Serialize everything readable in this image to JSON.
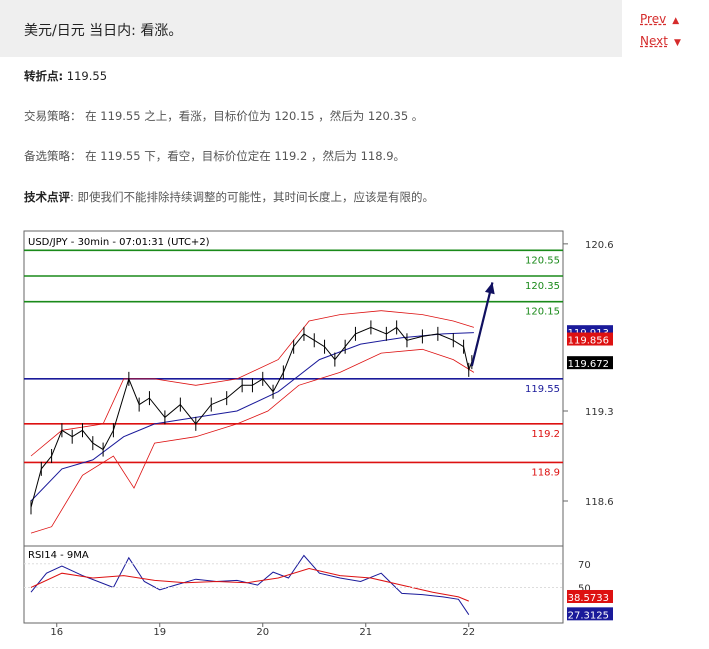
{
  "header": {
    "title": "美元/日元 当日内: 看涨。",
    "prev_label": "Prev",
    "next_label": "Next"
  },
  "analysis": {
    "pivot_label": "转折点:",
    "pivot_value": "119.55",
    "strategy_label": "交易策略：",
    "strategy_text": "在 119.55 之上，看涨，目标价位为 120.15 ，然后为 120.35 。",
    "alternative_label": "备选策略：",
    "alternative_text": "在 119.55 下，看空，目标价位定在 119.2 ，然后为 118.9。",
    "comment_label": "技术点评",
    "comment_text": ": 即使我们不能排除持续调整的可能性，其时间长度上，应该是有限的。"
  },
  "colors": {
    "accent": "#d52b2b",
    "resistance": "#1a8a1a",
    "pivot": "#1a1a9a",
    "support": "#dd1111",
    "bollinger": "#dd1111",
    "moving_average": "#1a1a9a"
  },
  "chart_data": [
    {
      "type": "candlestick",
      "title": "USD/JPY - 30min - 07:01:31 (UTC+2)",
      "ylim": [
        118.25,
        120.7
      ],
      "y_ticks": [
        120.6,
        119.3,
        118.6
      ],
      "x_ticks": [
        "16",
        "19",
        "20",
        "21",
        "22"
      ],
      "levels": [
        {
          "label": "120.55",
          "value": 120.55,
          "kind": "resistance"
        },
        {
          "label": "120.35",
          "value": 120.35,
          "kind": "resistance"
        },
        {
          "label": "120.15",
          "value": 120.15,
          "kind": "resistance"
        },
        {
          "label": "119.55",
          "value": 119.55,
          "kind": "pivot"
        },
        {
          "label": "119.2",
          "value": 119.2,
          "kind": "support"
        },
        {
          "label": "118.9",
          "value": 118.9,
          "kind": "support"
        }
      ],
      "price_tags": [
        {
          "label": "119.913",
          "value": 119.913,
          "bg": "#1a1a9a"
        },
        {
          "label": "119.856",
          "value": 119.856,
          "bg": "#dd1111"
        },
        {
          "label": "119.672",
          "value": 119.672,
          "bg": "#000000"
        }
      ],
      "price_path": [
        {
          "x": 0.0,
          "y": 118.55
        },
        {
          "x": 0.1,
          "y": 118.85
        },
        {
          "x": 0.2,
          "y": 118.95
        },
        {
          "x": 0.3,
          "y": 119.15
        },
        {
          "x": 0.4,
          "y": 119.1
        },
        {
          "x": 0.5,
          "y": 119.15
        },
        {
          "x": 0.6,
          "y": 119.05
        },
        {
          "x": 0.7,
          "y": 119.0
        },
        {
          "x": 0.8,
          "y": 119.15
        },
        {
          "x": 0.95,
          "y": 119.55
        },
        {
          "x": 1.05,
          "y": 119.35
        },
        {
          "x": 1.15,
          "y": 119.4
        },
        {
          "x": 1.3,
          "y": 119.25
        },
        {
          "x": 1.45,
          "y": 119.35
        },
        {
          "x": 1.6,
          "y": 119.2
        },
        {
          "x": 1.75,
          "y": 119.35
        },
        {
          "x": 1.9,
          "y": 119.4
        },
        {
          "x": 2.05,
          "y": 119.5
        },
        {
          "x": 2.15,
          "y": 119.5
        },
        {
          "x": 2.25,
          "y": 119.55
        },
        {
          "x": 2.35,
          "y": 119.45
        },
        {
          "x": 2.45,
          "y": 119.6
        },
        {
          "x": 2.55,
          "y": 119.8
        },
        {
          "x": 2.65,
          "y": 119.9
        },
        {
          "x": 2.75,
          "y": 119.85
        },
        {
          "x": 2.85,
          "y": 119.8
        },
        {
          "x": 2.95,
          "y": 119.7
        },
        {
          "x": 3.05,
          "y": 119.8
        },
        {
          "x": 3.15,
          "y": 119.9
        },
        {
          "x": 3.3,
          "y": 119.95
        },
        {
          "x": 3.45,
          "y": 119.9
        },
        {
          "x": 3.55,
          "y": 119.95
        },
        {
          "x": 3.65,
          "y": 119.85
        },
        {
          "x": 3.8,
          "y": 119.88
        },
        {
          "x": 3.95,
          "y": 119.9
        },
        {
          "x": 4.1,
          "y": 119.85
        },
        {
          "x": 4.2,
          "y": 119.8
        },
        {
          "x": 4.25,
          "y": 119.62
        },
        {
          "x": 4.28,
          "y": 119.68
        }
      ],
      "ma_path": [
        {
          "x": 0.0,
          "y": 118.6
        },
        {
          "x": 0.3,
          "y": 118.85
        },
        {
          "x": 0.6,
          "y": 118.92
        },
        {
          "x": 0.9,
          "y": 119.1
        },
        {
          "x": 1.2,
          "y": 119.2
        },
        {
          "x": 1.6,
          "y": 119.25
        },
        {
          "x": 2.0,
          "y": 119.3
        },
        {
          "x": 2.4,
          "y": 119.45
        },
        {
          "x": 2.8,
          "y": 119.7
        },
        {
          "x": 3.2,
          "y": 119.82
        },
        {
          "x": 3.6,
          "y": 119.87
        },
        {
          "x": 4.0,
          "y": 119.9
        },
        {
          "x": 4.3,
          "y": 119.91
        }
      ],
      "bb_upper": [
        {
          "x": 0.0,
          "y": 118.95
        },
        {
          "x": 0.3,
          "y": 119.15
        },
        {
          "x": 0.7,
          "y": 119.2
        },
        {
          "x": 0.9,
          "y": 119.55
        },
        {
          "x": 1.2,
          "y": 119.55
        },
        {
          "x": 1.6,
          "y": 119.5
        },
        {
          "x": 2.0,
          "y": 119.55
        },
        {
          "x": 2.4,
          "y": 119.7
        },
        {
          "x": 2.7,
          "y": 120.0
        },
        {
          "x": 3.0,
          "y": 120.05
        },
        {
          "x": 3.4,
          "y": 120.08
        },
        {
          "x": 3.8,
          "y": 120.05
        },
        {
          "x": 4.1,
          "y": 120.0
        },
        {
          "x": 4.3,
          "y": 119.95
        }
      ],
      "bb_lower": [
        {
          "x": 0.0,
          "y": 118.35
        },
        {
          "x": 0.2,
          "y": 118.4
        },
        {
          "x": 0.5,
          "y": 118.8
        },
        {
          "x": 0.8,
          "y": 118.95
        },
        {
          "x": 1.0,
          "y": 118.7
        },
        {
          "x": 1.2,
          "y": 119.05
        },
        {
          "x": 1.6,
          "y": 119.1
        },
        {
          "x": 2.0,
          "y": 119.2
        },
        {
          "x": 2.3,
          "y": 119.3
        },
        {
          "x": 2.6,
          "y": 119.5
        },
        {
          "x": 3.0,
          "y": 119.6
        },
        {
          "x": 3.4,
          "y": 119.75
        },
        {
          "x": 3.8,
          "y": 119.78
        },
        {
          "x": 4.1,
          "y": 119.7
        },
        {
          "x": 4.3,
          "y": 119.6
        }
      ],
      "forecast_arrow": {
        "from": {
          "x": 4.28,
          "y": 119.65
        },
        "to": {
          "x": 4.48,
          "y": 120.3
        }
      }
    },
    {
      "type": "line",
      "title": "RSI14 - 9MA",
      "ylim": [
        20,
        85
      ],
      "y_ticks": [
        70,
        50
      ],
      "price_tags": [
        {
          "label": "38.5733",
          "value": 38.5733,
          "bg": "#dd1111"
        },
        {
          "label": "27.3125",
          "value": 27.3125,
          "bg": "#1a1a9a"
        }
      ],
      "series": [
        {
          "name": "RSI14",
          "color": "#1a1a9a",
          "points": [
            {
              "x": 0.0,
              "y": 46
            },
            {
              "x": 0.15,
              "y": 62
            },
            {
              "x": 0.3,
              "y": 68
            },
            {
              "x": 0.5,
              "y": 60
            },
            {
              "x": 0.65,
              "y": 55
            },
            {
              "x": 0.8,
              "y": 50
            },
            {
              "x": 0.95,
              "y": 75
            },
            {
              "x": 1.1,
              "y": 55
            },
            {
              "x": 1.25,
              "y": 48
            },
            {
              "x": 1.4,
              "y": 52
            },
            {
              "x": 1.6,
              "y": 57
            },
            {
              "x": 1.8,
              "y": 55
            },
            {
              "x": 2.0,
              "y": 56
            },
            {
              "x": 2.2,
              "y": 52
            },
            {
              "x": 2.35,
              "y": 63
            },
            {
              "x": 2.5,
              "y": 58
            },
            {
              "x": 2.65,
              "y": 77
            },
            {
              "x": 2.8,
              "y": 62
            },
            {
              "x": 3.0,
              "y": 58
            },
            {
              "x": 3.2,
              "y": 55
            },
            {
              "x": 3.4,
              "y": 62
            },
            {
              "x": 3.6,
              "y": 45
            },
            {
              "x": 3.8,
              "y": 44
            },
            {
              "x": 4.0,
              "y": 42
            },
            {
              "x": 4.15,
              "y": 40
            },
            {
              "x": 4.25,
              "y": 27
            }
          ]
        },
        {
          "name": "9MA",
          "color": "#dd1111",
          "points": [
            {
              "x": 0.0,
              "y": 50
            },
            {
              "x": 0.3,
              "y": 62
            },
            {
              "x": 0.6,
              "y": 58
            },
            {
              "x": 0.9,
              "y": 60
            },
            {
              "x": 1.2,
              "y": 56
            },
            {
              "x": 1.5,
              "y": 54
            },
            {
              "x": 1.8,
              "y": 55
            },
            {
              "x": 2.1,
              "y": 54
            },
            {
              "x": 2.4,
              "y": 58
            },
            {
              "x": 2.7,
              "y": 66
            },
            {
              "x": 3.0,
              "y": 60
            },
            {
              "x": 3.3,
              "y": 58
            },
            {
              "x": 3.6,
              "y": 52
            },
            {
              "x": 3.9,
              "y": 46
            },
            {
              "x": 4.15,
              "y": 42
            },
            {
              "x": 4.25,
              "y": 38.5
            }
          ]
        }
      ]
    }
  ]
}
